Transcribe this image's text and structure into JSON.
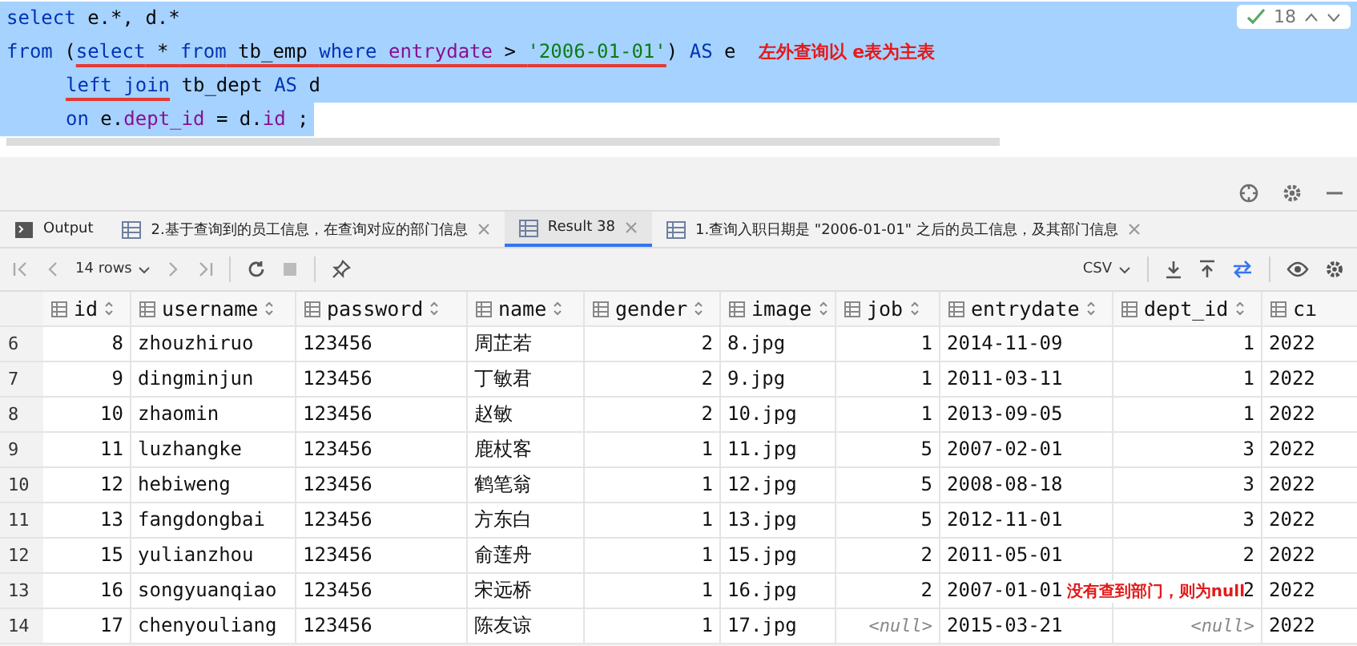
{
  "editor": {
    "lines": [
      {
        "indented": false,
        "tokens": [
          {
            "t": "select",
            "kind": "kw",
            "underlined": false
          },
          {
            "t": " e.*, d.*",
            "kind": "id",
            "underlined": false
          }
        ]
      },
      {
        "indented": false,
        "tokens": [
          {
            "t": "from",
            "kind": "kw",
            "underlined": false
          },
          {
            "t": " (",
            "kind": "id",
            "underlined": false
          },
          {
            "t": "select",
            "kind": "kw",
            "underlined": true
          },
          {
            "t": " * ",
            "kind": "id",
            "underlined": true
          },
          {
            "t": "from",
            "kind": "kw",
            "underlined": true
          },
          {
            "t": " tb_emp ",
            "kind": "id",
            "underlined": true
          },
          {
            "t": "where ",
            "kind": "kw",
            "underlined": true
          },
          {
            "t": "entrydate",
            "kind": "field",
            "underlined": true
          },
          {
            "t": " > ",
            "kind": "id",
            "underlined": true
          },
          {
            "t": "'2006-01-01'",
            "kind": "str",
            "underlined": true
          },
          {
            "t": ") ",
            "kind": "id",
            "underlined": false
          },
          {
            "t": "AS",
            "kind": "kw",
            "underlined": false
          },
          {
            "t": " e",
            "kind": "id",
            "underlined": false
          }
        ]
      },
      {
        "indented": true,
        "tokens": [
          {
            "t": "left join",
            "kind": "kw",
            "underlined": true
          },
          {
            "t": " tb_dept ",
            "kind": "id",
            "underlined": false
          },
          {
            "t": "AS",
            "kind": "kw",
            "underlined": false
          },
          {
            "t": " d",
            "kind": "id",
            "underlined": false
          }
        ]
      },
      {
        "indented": true,
        "tokens": [
          {
            "t": "on",
            "kind": "kw",
            "underlined": false
          },
          {
            "t": " e.",
            "kind": "id",
            "underlined": false
          },
          {
            "t": "dept_id",
            "kind": "field",
            "underlined": false
          },
          {
            "t": " = d.",
            "kind": "id",
            "underlined": false
          },
          {
            "t": "id",
            "kind": "field",
            "underlined": false
          },
          {
            "t": " ;",
            "kind": "id",
            "underlined": false
          }
        ]
      }
    ],
    "note": "左外查询以 e表为主表",
    "inspection_count": "18"
  },
  "tabs": [
    {
      "label": "Output",
      "selected": false,
      "kind": "output"
    },
    {
      "label": "2.基于查询到的员工信息，在查询对应的部门信息",
      "selected": false,
      "kind": "table"
    },
    {
      "label": "Result 38",
      "selected": true,
      "kind": "table"
    },
    {
      "label": "1.查询入职日期是 \"2006-01-01\" 之后的员工信息，及其部门信息",
      "selected": false,
      "kind": "table"
    }
  ],
  "toolbar": {
    "rows": "14 rows",
    "export": "CSV"
  },
  "table": {
    "columns": [
      {
        "name": "id",
        "numeric": true
      },
      {
        "name": "username",
        "numeric": false
      },
      {
        "name": "password",
        "numeric": false
      },
      {
        "name": "name",
        "numeric": false
      },
      {
        "name": "gender",
        "numeric": true
      },
      {
        "name": "image",
        "numeric": false
      },
      {
        "name": "job",
        "numeric": true
      },
      {
        "name": "entrydate",
        "numeric": false
      },
      {
        "name": "dept_id",
        "numeric": true
      },
      {
        "name": "cı",
        "numeric": false
      }
    ],
    "rows": [
      {
        "num": "6",
        "cells": [
          "8",
          "zhouzhiruo",
          "123456",
          "周芷若",
          "2",
          "8.jpg",
          "1",
          "2014-11-09",
          "1",
          "2022"
        ]
      },
      {
        "num": "7",
        "cells": [
          "9",
          "dingminjun",
          "123456",
          "丁敏君",
          "2",
          "9.jpg",
          "1",
          "2011-03-11",
          "1",
          "2022"
        ]
      },
      {
        "num": "8",
        "cells": [
          "10",
          "zhaomin",
          "123456",
          "赵敏",
          "2",
          "10.jpg",
          "1",
          "2013-09-05",
          "1",
          "2022"
        ]
      },
      {
        "num": "9",
        "cells": [
          "11",
          "luzhangke",
          "123456",
          "鹿杖客",
          "1",
          "11.jpg",
          "5",
          "2007-02-01",
          "3",
          "2022"
        ]
      },
      {
        "num": "10",
        "cells": [
          "12",
          "hebiweng",
          "123456",
          "鹤笔翁",
          "1",
          "12.jpg",
          "5",
          "2008-08-18",
          "3",
          "2022"
        ]
      },
      {
        "num": "11",
        "cells": [
          "13",
          "fangdongbai",
          "123456",
          "方东白",
          "1",
          "13.jpg",
          "5",
          "2012-11-01",
          "3",
          "2022"
        ]
      },
      {
        "num": "12",
        "cells": [
          "15",
          "yulianzhou",
          "123456",
          "俞莲舟",
          "1",
          "15.jpg",
          "2",
          "2011-05-01",
          "2",
          "2022"
        ]
      },
      {
        "num": "13",
        "cells": [
          "16",
          "songyuanqiao",
          "123456",
          "宋远桥",
          "1",
          "16.jpg",
          "2",
          "2007-01-01",
          "2",
          "2022"
        ]
      },
      {
        "num": "14",
        "cells": [
          "17",
          "chenyouliang",
          "123456",
          "陈友谅",
          "1",
          "17.jpg",
          {
            "text": "<null>",
            "kind": "null"
          },
          "2015-03-21",
          {
            "text": "<null>",
            "kind": "null"
          },
          "2022"
        ]
      }
    ],
    "note": "没有查到部门，则为null"
  }
}
